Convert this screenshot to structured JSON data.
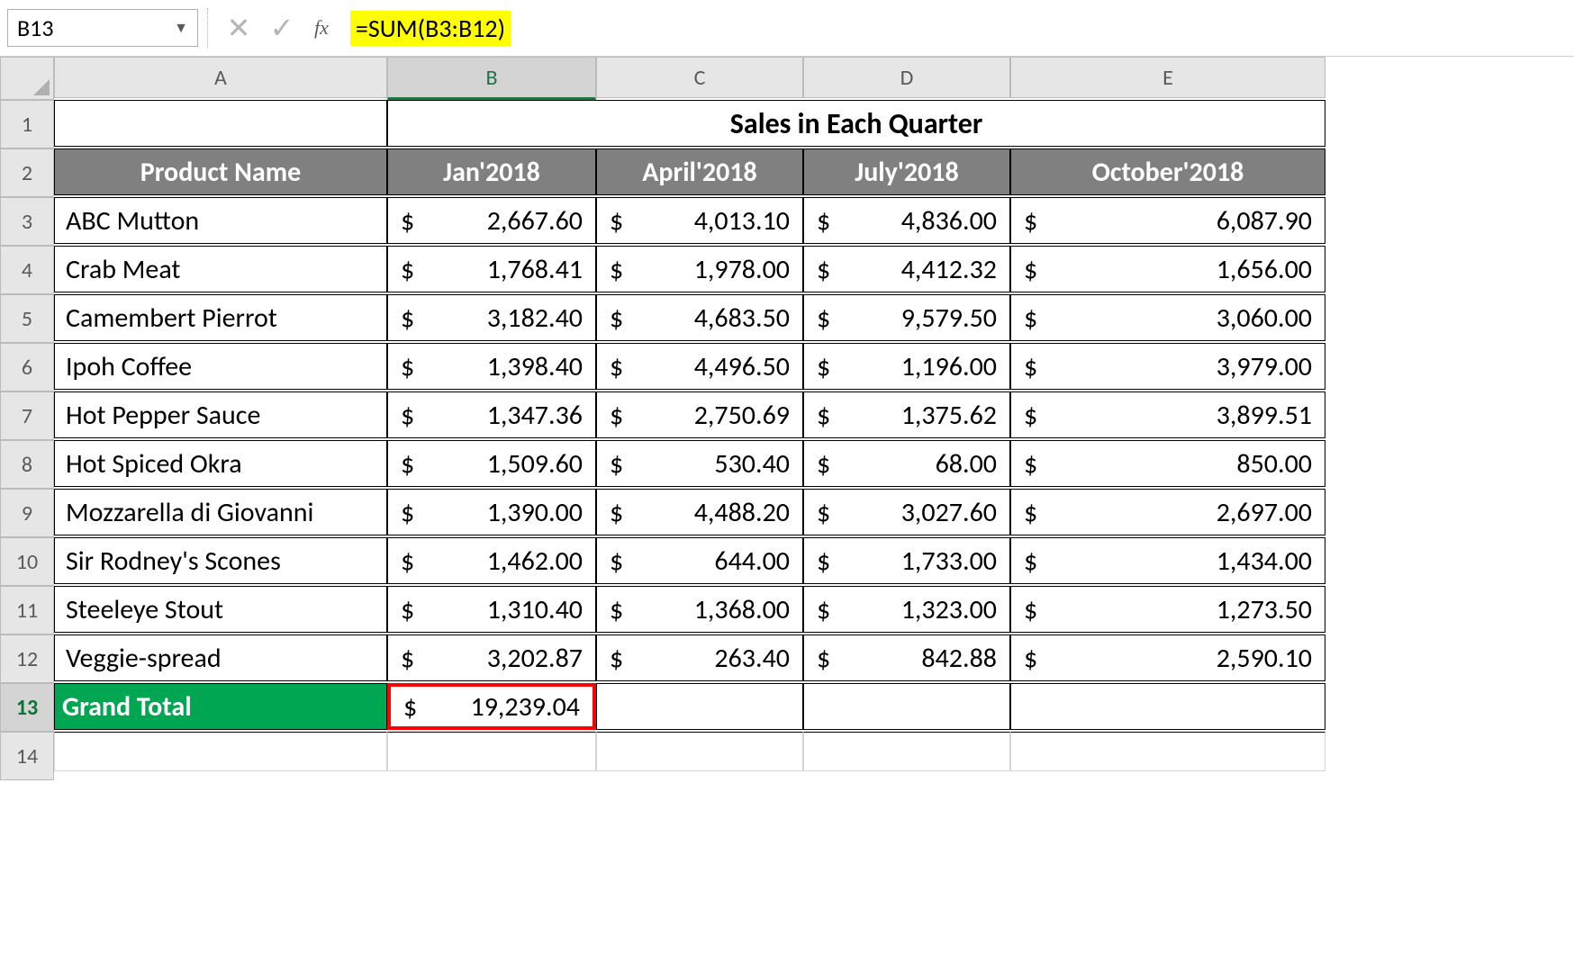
{
  "namebox": "B13",
  "fx_label": "fx",
  "formula": "=SUM(B3:B12)",
  "col_headers": [
    "A",
    "B",
    "C",
    "D",
    "E"
  ],
  "row_headers": [
    "1",
    "2",
    "3",
    "4",
    "5",
    "6",
    "7",
    "8",
    "9",
    "10",
    "11",
    "12",
    "13",
    "14"
  ],
  "sales_title": "Sales in Each Quarter",
  "product_header": "Product Name",
  "quarter_headers": [
    "Jan'2018",
    "April'2018",
    "July'2018",
    "October'2018"
  ],
  "products": [
    {
      "name": "ABC Mutton",
      "q": [
        "2,667.60",
        "4,013.10",
        "4,836.00",
        "6,087.90"
      ]
    },
    {
      "name": "Crab Meat",
      "q": [
        "1,768.41",
        "1,978.00",
        "4,412.32",
        "1,656.00"
      ]
    },
    {
      "name": "Camembert Pierrot",
      "q": [
        "3,182.40",
        "4,683.50",
        "9,579.50",
        "3,060.00"
      ]
    },
    {
      "name": "Ipoh Coffee",
      "q": [
        "1,398.40",
        "4,496.50",
        "1,196.00",
        "3,979.00"
      ]
    },
    {
      "name": "Hot Pepper Sauce",
      "q": [
        "1,347.36",
        "2,750.69",
        "1,375.62",
        "3,899.51"
      ]
    },
    {
      "name": " Hot Spiced Okra",
      "q": [
        "1,509.60",
        "530.40",
        "68.00",
        "850.00"
      ]
    },
    {
      "name": "Mozzarella di Giovanni",
      "q": [
        "1,390.00",
        "4,488.20",
        "3,027.60",
        "2,697.00"
      ]
    },
    {
      "name": "Sir Rodney's Scones",
      "q": [
        "1,462.00",
        "644.00",
        "1,733.00",
        "1,434.00"
      ]
    },
    {
      "name": "Steeleye Stout",
      "q": [
        "1,310.40",
        "1,368.00",
        "1,323.00",
        "1,273.50"
      ]
    },
    {
      "name": "Veggie-spread",
      "q": [
        "3,202.87",
        "263.40",
        "842.88",
        "2,590.10"
      ]
    }
  ],
  "grand_total_label": "Grand Total",
  "grand_total_value": "19,239.04",
  "dollar": "$",
  "chart_data": {
    "type": "table",
    "title": "Sales in Each Quarter",
    "columns": [
      "Product Name",
      "Jan'2018",
      "April'2018",
      "July'2018",
      "October'2018"
    ],
    "rows": [
      [
        "ABC Mutton",
        2667.6,
        4013.1,
        4836.0,
        6087.9
      ],
      [
        "Crab Meat",
        1768.41,
        1978.0,
        4412.32,
        1656.0
      ],
      [
        "Camembert Pierrot",
        3182.4,
        4683.5,
        9579.5,
        3060.0
      ],
      [
        "Ipoh Coffee",
        1398.4,
        4496.5,
        1196.0,
        3979.0
      ],
      [
        "Hot Pepper Sauce",
        1347.36,
        2750.69,
        1375.62,
        3899.51
      ],
      [
        "Hot Spiced Okra",
        1509.6,
        530.4,
        68.0,
        850.0
      ],
      [
        "Mozzarella di Giovanni",
        1390.0,
        4488.2,
        3027.6,
        2697.0
      ],
      [
        "Sir Rodney's Scones",
        1462.0,
        644.0,
        1733.0,
        1434.0
      ],
      [
        "Steeleye Stout",
        1310.4,
        1368.0,
        1323.0,
        1273.5
      ],
      [
        "Veggie-spread",
        3202.87,
        263.4,
        842.88,
        2590.1
      ]
    ],
    "totals": {
      "Jan'2018": 19239.04
    }
  }
}
